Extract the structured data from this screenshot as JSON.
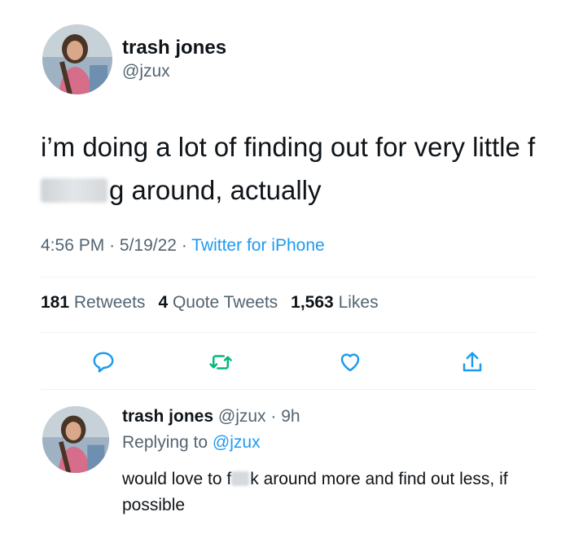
{
  "tweet": {
    "author_name": "trash jones",
    "author_handle": "@jzux",
    "text_part1": "i’m doing a lot of finding out for very little f",
    "text_part2": "g around, actually",
    "time": "4:56 PM",
    "date": "5/19/22",
    "source": "Twitter for iPhone",
    "stats": {
      "retweets_count": "181",
      "retweets_label": "Retweets",
      "quote_count": "4",
      "quote_label": "Quote Tweets",
      "likes_count": "1,563",
      "likes_label": "Likes"
    }
  },
  "actions": {
    "icons": [
      "reply-icon",
      "retweet-icon",
      "like-icon",
      "share-icon"
    ]
  },
  "reply": {
    "author_name": "trash jones",
    "author_handle": "@jzux",
    "age": "9h",
    "replying_label": "Replying to",
    "replying_to": "@jzux",
    "text_part1": "would love to f",
    "text_part2": "k around more and find out less, if possible"
  },
  "colors": {
    "accent": "#1d9bf0",
    "retweet": "#00ba7c",
    "muted": "#536471",
    "text": "#0f1419"
  }
}
